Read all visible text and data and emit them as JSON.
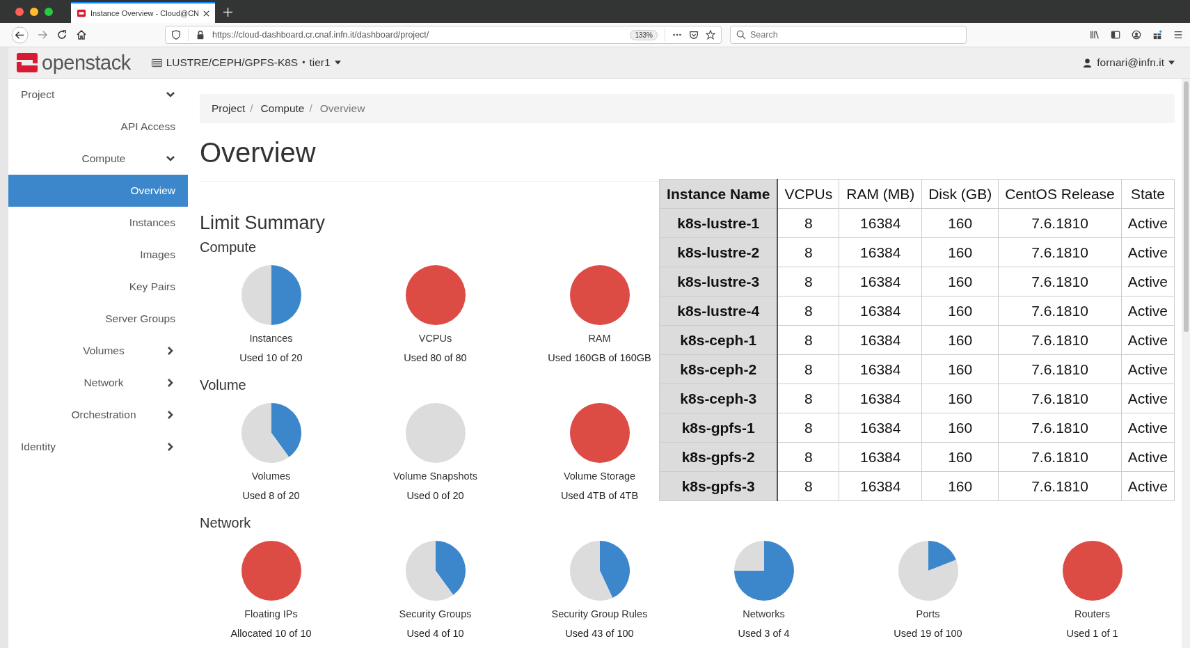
{
  "browser": {
    "tab_title": "Instance Overview - Cloud@CN",
    "url": "https://cloud-dashboard.cr.cnaf.infn.it/dashboard/project/",
    "zoom": "133%",
    "search": {
      "placeholder": "Search"
    }
  },
  "header": {
    "logo": "openstack",
    "project": "LUSTRE/CEPH/GPFS-K8S",
    "separator": "•",
    "region": "tier1",
    "user": "fornari@infn.it"
  },
  "sidebar": {
    "items": [
      {
        "label": "Project",
        "kind": "section",
        "expanded": true,
        "selected": false
      },
      {
        "label": "API Access",
        "kind": "link",
        "selected": false
      },
      {
        "label": "Compute",
        "kind": "group",
        "expanded": true,
        "selected": false
      },
      {
        "label": "Overview",
        "kind": "link",
        "selected": true
      },
      {
        "label": "Instances",
        "kind": "link",
        "selected": false
      },
      {
        "label": "Images",
        "kind": "link",
        "selected": false
      },
      {
        "label": "Key Pairs",
        "kind": "link",
        "selected": false
      },
      {
        "label": "Server Groups",
        "kind": "link",
        "selected": false
      },
      {
        "label": "Volumes",
        "kind": "group",
        "expanded": false,
        "selected": false
      },
      {
        "label": "Network",
        "kind": "group",
        "expanded": false,
        "selected": false
      },
      {
        "label": "Orchestration",
        "kind": "group",
        "expanded": false,
        "selected": false
      },
      {
        "label": "Identity",
        "kind": "section",
        "expanded": false,
        "selected": false
      }
    ]
  },
  "breadcrumb": [
    {
      "label": "Project",
      "separator": "/"
    },
    {
      "label": "Compute",
      "separator": "/"
    },
    {
      "label": "Overview"
    }
  ],
  "title": "Overview",
  "limit_summary": {
    "title": "Limit Summary",
    "sections": [
      {
        "title": "Compute",
        "meters": [
          {
            "label": "Instances",
            "usage": "Used 10 of 20",
            "chart_data": {
              "type": "pie",
              "values": [
                50,
                50
              ]
            }
          },
          {
            "label": "VCPUs",
            "usage": "Used 80 of 80",
            "chart_data": {
              "type": "pie",
              "values": [
                100,
                0
              ]
            }
          },
          {
            "label": "RAM",
            "usage": "Used 160GB of 160GB",
            "chart_data": {
              "type": "pie",
              "values": [
                100,
                0
              ]
            }
          }
        ]
      },
      {
        "title": "Volume",
        "meters": [
          {
            "label": "Volumes",
            "usage": "Used 8 of 20",
            "chart_data": {
              "type": "pie",
              "values": [
                40,
                60
              ]
            }
          },
          {
            "label": "Volume Snapshots",
            "usage": "Used 0 of 20",
            "chart_data": {
              "type": "pie",
              "values": [
                0,
                100
              ]
            }
          },
          {
            "label": "Volume Storage",
            "usage": "Used 4TB of 4TB",
            "chart_data": {
              "type": "pie",
              "values": [
                100,
                0
              ]
            }
          }
        ]
      },
      {
        "title": "Network",
        "meters": [
          {
            "label": "Floating IPs",
            "usage": "Allocated 10 of 10",
            "chart_data": {
              "type": "pie",
              "values": [
                100,
                0
              ]
            }
          },
          {
            "label": "Security Groups",
            "usage": "Used 4 of 10",
            "chart_data": {
              "type": "pie",
              "values": [
                40,
                60
              ]
            }
          },
          {
            "label": "Security Group Rules",
            "usage": "Used 43 of 100",
            "chart_data": {
              "type": "pie",
              "values": [
                43,
                57
              ]
            }
          },
          {
            "label": "Networks",
            "usage": "Used 3 of 4",
            "chart_data": {
              "type": "pie",
              "values": [
                75,
                25
              ]
            }
          },
          {
            "label": "Ports",
            "usage": "Used 19 of 100",
            "chart_data": {
              "type": "pie",
              "values": [
                19,
                81
              ]
            }
          },
          {
            "label": "Routers",
            "usage": "Used 1 of 1",
            "chart_data": {
              "type": "pie",
              "values": [
                100,
                0
              ]
            }
          }
        ]
      }
    ]
  },
  "table": {
    "columns": [
      "Instance Name",
      "VCPUs",
      "RAM (MB)",
      "Disk (GB)",
      "CentOS Release",
      "State"
    ],
    "rows": [
      [
        "k8s-lustre-1",
        "8",
        "16384",
        "160",
        "7.6.1810",
        "Active"
      ],
      [
        "k8s-lustre-2",
        "8",
        "16384",
        "160",
        "7.6.1810",
        "Active"
      ],
      [
        "k8s-lustre-3",
        "8",
        "16384",
        "160",
        "7.6.1810",
        "Active"
      ],
      [
        "k8s-lustre-4",
        "8",
        "16384",
        "160",
        "7.6.1810",
        "Active"
      ],
      [
        "k8s-ceph-1",
        "8",
        "16384",
        "160",
        "7.6.1810",
        "Active"
      ],
      [
        "k8s-ceph-2",
        "8",
        "16384",
        "160",
        "7.6.1810",
        "Active"
      ],
      [
        "k8s-ceph-3",
        "8",
        "16384",
        "160",
        "7.6.1810",
        "Active"
      ],
      [
        "k8s-gpfs-1",
        "8",
        "16384",
        "160",
        "7.6.1810",
        "Active"
      ],
      [
        "k8s-gpfs-2",
        "8",
        "16384",
        "160",
        "7.6.1810",
        "Active"
      ],
      [
        "k8s-gpfs-3",
        "8",
        "16384",
        "160",
        "7.6.1810",
        "Active"
      ]
    ]
  }
}
